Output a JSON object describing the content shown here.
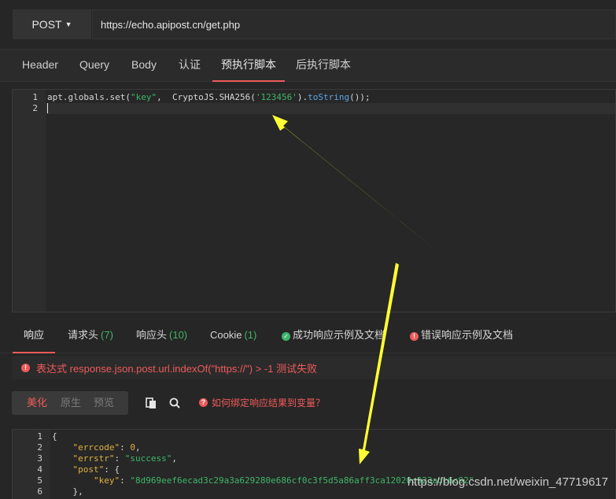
{
  "request": {
    "method": "POST",
    "url": "https://echo.apipost.cn/get.php"
  },
  "request_tabs": [
    {
      "label": "Header",
      "active": false
    },
    {
      "label": "Query",
      "active": false
    },
    {
      "label": "Body",
      "active": false
    },
    {
      "label": "认证",
      "active": false
    },
    {
      "label": "预执行脚本",
      "active": true
    },
    {
      "label": "后执行脚本",
      "active": false
    }
  ],
  "script_editor": {
    "line_numbers": [
      "1",
      "2"
    ],
    "line1": {
      "prefix": "apt.globals.set(",
      "arg1": "\"key\"",
      "mid": ",  CryptoJS.SHA256(",
      "arg2": "'123456'",
      "suffix1": ").",
      "method": "toString",
      "suffix2": "());"
    }
  },
  "response_tabs": [
    {
      "label": "响应",
      "count": "",
      "active": true
    },
    {
      "label": "请求头",
      "count": "(7)",
      "active": false
    },
    {
      "label": "响应头",
      "count": "(10)",
      "active": false
    },
    {
      "label": "Cookie",
      "count": "(1)",
      "active": false
    },
    {
      "label": "成功响应示例及文档",
      "count": "",
      "active": false,
      "icon": "check-circle-icon"
    },
    {
      "label": "错误响应示例及文档",
      "count": "",
      "active": false,
      "icon": "error-circle-icon"
    }
  ],
  "assertion_error": "表达式 response.json.post.url.indexOf(\"https://\") > -1 测试失败",
  "format_buttons": [
    {
      "label": "美化",
      "active": true
    },
    {
      "label": "原生",
      "active": false
    },
    {
      "label": "预览",
      "active": false
    }
  ],
  "bind_hint": "如何绑定响应结果到变量？",
  "response_editor": {
    "line_numbers": [
      "1",
      "2",
      "3",
      "4",
      "5",
      "6"
    ],
    "l1": "{",
    "l2_key": "\"errcode\"",
    "l2_val": "0",
    "l3_key": "\"errstr\"",
    "l3_val": "\"success\"",
    "l4_key": "\"post\"",
    "l4_rest": ": {",
    "l5_key": "\"key\"",
    "l5_val": "\"8d969eef6ecad3c29a3a629280e686cf0c3f5d5a86aff3ca12020c923adc6c92\"",
    "l6": "},"
  },
  "watermark": "https://blog.csdn.net/weixin_47719617",
  "colors": {
    "accent": "#f05a5a",
    "success": "#3fb56a",
    "arrow": "#ffff33"
  }
}
